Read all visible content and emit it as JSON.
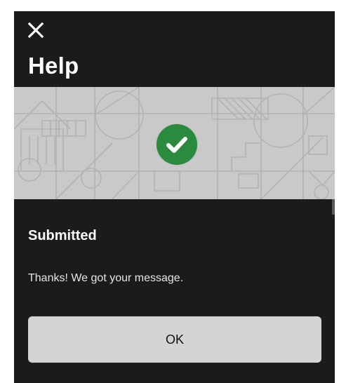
{
  "dialog": {
    "title": "Help",
    "close_icon": "close-icon"
  },
  "banner": {
    "status_icon": "check-circle-icon",
    "icon_color": "#2a8a3e",
    "background_color": "#c9c9c9"
  },
  "status": {
    "heading": "Submitted",
    "message": "Thanks! We got your message."
  },
  "actions": {
    "ok_label": "OK"
  },
  "colors": {
    "panel_background": "#1b1b1b",
    "button_background": "#d4d4d4"
  }
}
